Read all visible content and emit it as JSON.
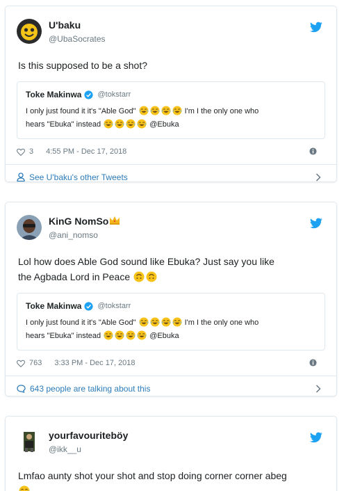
{
  "tweets": [
    {
      "author": "U'baku",
      "handle": "@UbaSocrates",
      "text": "Is this supposed to be a shot?",
      "quote": {
        "author": "Toke Makinwa",
        "handle": "@tokstarr",
        "line1_pre": "I only just found it it's \"Able God\"",
        "line1_post": "I'm I the only one who",
        "line2_pre": "hears  \"Ebuka\" instead",
        "line2_post": "@Ebuka"
      },
      "likes": "3",
      "timestamp": "4:55 PM - Dec 17, 2018",
      "footer": "See U'baku's other Tweets"
    },
    {
      "author": "KinG NomSo",
      "handle": "@ani_nomso",
      "text_line1": "Lol how does Able God sound like Ebuka? Just say you like",
      "text_line2": "the Agbada Lord in Peace",
      "quote": {
        "author": "Toke Makinwa",
        "handle": "@tokstarr",
        "line1_pre": "I only just found it it's \"Able God\"",
        "line1_post": "I'm I the only one who",
        "line2_pre": "hears  \"Ebuka\" instead",
        "line2_post": "@Ebuka"
      },
      "likes": "763",
      "timestamp": "3:33 PM - Dec 17, 2018",
      "footer": "643 people are talking about this"
    },
    {
      "author": "yourfavouriteböy",
      "handle": "@ikk__u",
      "text": "Lmfao aunty shot your shot and stop doing corner corner abeg"
    }
  ],
  "colors": {
    "twitter_blue": "#1da1f2",
    "link_blue": "#2b7bb9",
    "muted": "#697882",
    "border": "#e1e8ed"
  }
}
